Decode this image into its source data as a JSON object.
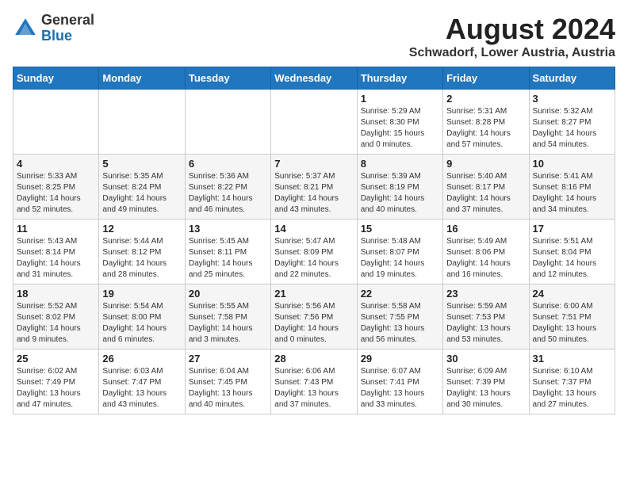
{
  "header": {
    "logo_general": "General",
    "logo_blue": "Blue",
    "main_title": "August 2024",
    "subtitle": "Schwadorf, Lower Austria, Austria"
  },
  "weekdays": [
    "Sunday",
    "Monday",
    "Tuesday",
    "Wednesday",
    "Thursday",
    "Friday",
    "Saturday"
  ],
  "weeks": [
    [
      {
        "day": "",
        "detail": ""
      },
      {
        "day": "",
        "detail": ""
      },
      {
        "day": "",
        "detail": ""
      },
      {
        "day": "",
        "detail": ""
      },
      {
        "day": "1",
        "detail": "Sunrise: 5:29 AM\nSunset: 8:30 PM\nDaylight: 15 hours\nand 0 minutes."
      },
      {
        "day": "2",
        "detail": "Sunrise: 5:31 AM\nSunset: 8:28 PM\nDaylight: 14 hours\nand 57 minutes."
      },
      {
        "day": "3",
        "detail": "Sunrise: 5:32 AM\nSunset: 8:27 PM\nDaylight: 14 hours\nand 54 minutes."
      }
    ],
    [
      {
        "day": "4",
        "detail": "Sunrise: 5:33 AM\nSunset: 8:25 PM\nDaylight: 14 hours\nand 52 minutes."
      },
      {
        "day": "5",
        "detail": "Sunrise: 5:35 AM\nSunset: 8:24 PM\nDaylight: 14 hours\nand 49 minutes."
      },
      {
        "day": "6",
        "detail": "Sunrise: 5:36 AM\nSunset: 8:22 PM\nDaylight: 14 hours\nand 46 minutes."
      },
      {
        "day": "7",
        "detail": "Sunrise: 5:37 AM\nSunset: 8:21 PM\nDaylight: 14 hours\nand 43 minutes."
      },
      {
        "day": "8",
        "detail": "Sunrise: 5:39 AM\nSunset: 8:19 PM\nDaylight: 14 hours\nand 40 minutes."
      },
      {
        "day": "9",
        "detail": "Sunrise: 5:40 AM\nSunset: 8:17 PM\nDaylight: 14 hours\nand 37 minutes."
      },
      {
        "day": "10",
        "detail": "Sunrise: 5:41 AM\nSunset: 8:16 PM\nDaylight: 14 hours\nand 34 minutes."
      }
    ],
    [
      {
        "day": "11",
        "detail": "Sunrise: 5:43 AM\nSunset: 8:14 PM\nDaylight: 14 hours\nand 31 minutes."
      },
      {
        "day": "12",
        "detail": "Sunrise: 5:44 AM\nSunset: 8:12 PM\nDaylight: 14 hours\nand 28 minutes."
      },
      {
        "day": "13",
        "detail": "Sunrise: 5:45 AM\nSunset: 8:11 PM\nDaylight: 14 hours\nand 25 minutes."
      },
      {
        "day": "14",
        "detail": "Sunrise: 5:47 AM\nSunset: 8:09 PM\nDaylight: 14 hours\nand 22 minutes."
      },
      {
        "day": "15",
        "detail": "Sunrise: 5:48 AM\nSunset: 8:07 PM\nDaylight: 14 hours\nand 19 minutes."
      },
      {
        "day": "16",
        "detail": "Sunrise: 5:49 AM\nSunset: 8:06 PM\nDaylight: 14 hours\nand 16 minutes."
      },
      {
        "day": "17",
        "detail": "Sunrise: 5:51 AM\nSunset: 8:04 PM\nDaylight: 14 hours\nand 12 minutes."
      }
    ],
    [
      {
        "day": "18",
        "detail": "Sunrise: 5:52 AM\nSunset: 8:02 PM\nDaylight: 14 hours\nand 9 minutes."
      },
      {
        "day": "19",
        "detail": "Sunrise: 5:54 AM\nSunset: 8:00 PM\nDaylight: 14 hours\nand 6 minutes."
      },
      {
        "day": "20",
        "detail": "Sunrise: 5:55 AM\nSunset: 7:58 PM\nDaylight: 14 hours\nand 3 minutes."
      },
      {
        "day": "21",
        "detail": "Sunrise: 5:56 AM\nSunset: 7:56 PM\nDaylight: 14 hours\nand 0 minutes."
      },
      {
        "day": "22",
        "detail": "Sunrise: 5:58 AM\nSunset: 7:55 PM\nDaylight: 13 hours\nand 56 minutes."
      },
      {
        "day": "23",
        "detail": "Sunrise: 5:59 AM\nSunset: 7:53 PM\nDaylight: 13 hours\nand 53 minutes."
      },
      {
        "day": "24",
        "detail": "Sunrise: 6:00 AM\nSunset: 7:51 PM\nDaylight: 13 hours\nand 50 minutes."
      }
    ],
    [
      {
        "day": "25",
        "detail": "Sunrise: 6:02 AM\nSunset: 7:49 PM\nDaylight: 13 hours\nand 47 minutes."
      },
      {
        "day": "26",
        "detail": "Sunrise: 6:03 AM\nSunset: 7:47 PM\nDaylight: 13 hours\nand 43 minutes."
      },
      {
        "day": "27",
        "detail": "Sunrise: 6:04 AM\nSunset: 7:45 PM\nDaylight: 13 hours\nand 40 minutes."
      },
      {
        "day": "28",
        "detail": "Sunrise: 6:06 AM\nSunset: 7:43 PM\nDaylight: 13 hours\nand 37 minutes."
      },
      {
        "day": "29",
        "detail": "Sunrise: 6:07 AM\nSunset: 7:41 PM\nDaylight: 13 hours\nand 33 minutes."
      },
      {
        "day": "30",
        "detail": "Sunrise: 6:09 AM\nSunset: 7:39 PM\nDaylight: 13 hours\nand 30 minutes."
      },
      {
        "day": "31",
        "detail": "Sunrise: 6:10 AM\nSunset: 7:37 PM\nDaylight: 13 hours\nand 27 minutes."
      }
    ]
  ]
}
